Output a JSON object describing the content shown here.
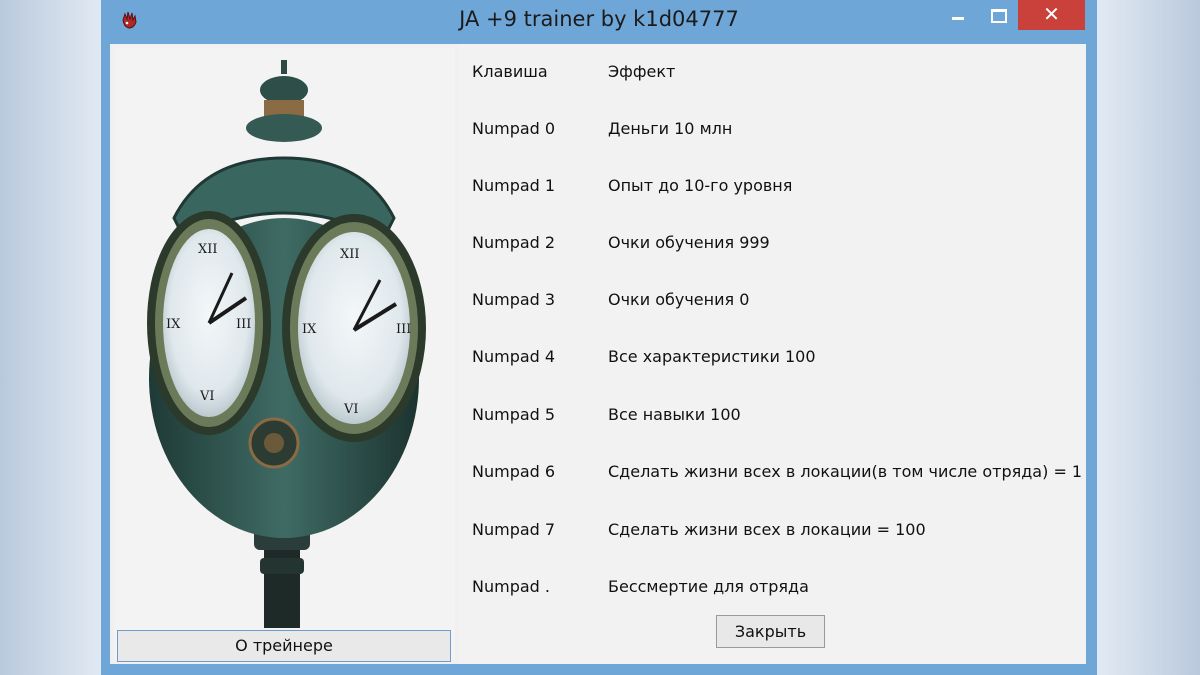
{
  "window": {
    "title": "JA +9 trainer by k1d04777",
    "controls": {
      "minimize": "minimize-icon",
      "maximize": "maximize-icon",
      "close": "close-icon",
      "close_glyph": "✕"
    },
    "app_icon": "hand-icon"
  },
  "left_panel": {
    "image": "street-clock-photo",
    "about_button": "О трейнере"
  },
  "table": {
    "headers": {
      "key": "Клавиша",
      "effect": "Эффект"
    },
    "rows": [
      {
        "key": "Numpad 0",
        "effect": "Деньги 10 млн"
      },
      {
        "key": "Numpad 1",
        "effect": "Опыт до 10-го уровня"
      },
      {
        "key": "Numpad 2",
        "effect": "Очки обучения 999"
      },
      {
        "key": "Numpad 3",
        "effect": "Очки обучения 0"
      },
      {
        "key": "Numpad 4",
        "effect": "Все характеристики 100"
      },
      {
        "key": "Numpad 5",
        "effect": "Все навыки 100"
      },
      {
        "key": "Numpad 6",
        "effect": "Сделать жизни всех в локации(в том числе отряда) = 1"
      },
      {
        "key": "Numpad 7",
        "effect": "Сделать жизни всех в локации = 100"
      },
      {
        "key": "Numpad .",
        "effect": "Бессмертие для отряда"
      }
    ]
  },
  "close_button": "Закрыть",
  "colors": {
    "titlebar": "#6fa6d8",
    "close": "#c9413a",
    "panel": "#f0f0f0"
  }
}
